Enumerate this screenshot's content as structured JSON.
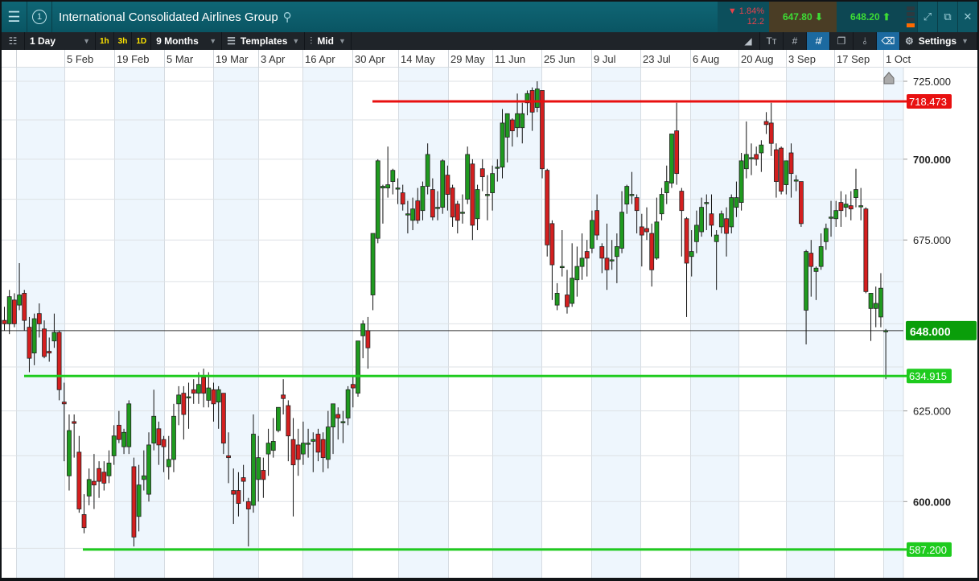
{
  "window": {
    "title": "International Consolidated Airlines Group",
    "number": "1"
  },
  "quote": {
    "change_pct": "▼ 1.84%",
    "change_abs": "12.2",
    "sell": "647.80",
    "buy": "648.20"
  },
  "toolbar": {
    "interval": "1 Day",
    "quick": [
      "1h",
      "3h",
      "1D"
    ],
    "range": "9 Months",
    "templates": "Templates",
    "price_type": "Mid",
    "settings": "Settings"
  },
  "colors": {
    "up": "#1f9a1f",
    "down": "#d41f1f",
    "resistance": "#e81010",
    "support": "#1ecb1e",
    "current": "#0a9e0a"
  },
  "date_labels": [
    "5 Feb",
    "19 Feb",
    "5 Mar",
    "19 Mar",
    "3 Apr",
    "16 Apr",
    "30 Apr",
    "14 May",
    "29 May",
    "11 Jun",
    "25 Jun",
    "9 Jul",
    "23 Jul",
    "6 Aug",
    "20 Aug",
    "3 Sep",
    "17 Sep",
    "1 Oct"
  ],
  "chart_data": {
    "type": "candlestick",
    "scale": "log",
    "price_ticks": [
      "725.000",
      "700.000",
      "675.000",
      "625.000",
      "600.000"
    ],
    "current_price": 648.0,
    "current_label": "648.000",
    "levels": [
      {
        "name": "resistance",
        "value": 718.473,
        "label": "718.473"
      },
      {
        "name": "support-1",
        "value": 634.915,
        "label": "634.915"
      },
      {
        "name": "support-2",
        "value": 587.2,
        "label": "587.200"
      }
    ],
    "candles": [
      [
        651,
        655,
        648,
        650
      ],
      [
        650,
        660,
        647,
        658
      ],
      [
        657,
        659,
        649,
        650
      ],
      [
        655.5,
        668,
        654,
        658.5
      ],
      [
        659,
        660,
        648,
        651
      ],
      [
        649,
        652,
        636,
        640
      ],
      [
        641.5,
        653,
        638,
        651.5
      ],
      [
        653,
        656,
        646,
        650
      ],
      [
        648.5,
        651,
        640,
        640.5
      ],
      [
        642,
        646,
        639,
        641.5
      ],
      [
        645,
        653,
        643,
        647.5
      ],
      [
        647.5,
        648,
        628,
        631
      ],
      [
        627.5,
        633,
        611,
        627
      ],
      [
        607,
        624,
        603,
        619.5
      ],
      [
        622,
        624,
        612,
        621.5
      ],
      [
        613.5,
        618,
        597,
        598
      ],
      [
        596.5,
        602,
        591.5,
        593
      ],
      [
        601.5,
        609,
        599,
        606
      ],
      [
        605.5,
        613,
        598,
        604.5
      ],
      [
        609,
        611,
        601,
        605.5
      ],
      [
        608,
        611,
        603,
        605
      ],
      [
        607,
        614,
        605,
        610.5
      ],
      [
        612.5,
        621,
        610,
        618
      ],
      [
        621,
        625,
        616,
        617
      ],
      [
        615,
        620,
        613,
        619
      ],
      [
        615,
        628,
        613,
        627
      ],
      [
        609.5,
        612,
        588,
        590.5
      ],
      [
        596,
        610,
        592,
        604.5
      ],
      [
        606,
        614,
        603,
        607
      ],
      [
        602,
        619,
        600,
        615.5
      ],
      [
        616,
        631,
        614,
        623.5
      ],
      [
        620,
        622,
        610,
        615.5
      ],
      [
        617,
        618,
        608,
        615
      ],
      [
        609.5,
        618,
        606,
        611.5
      ],
      [
        611.5,
        627,
        608,
        623.5
      ],
      [
        627,
        632,
        621,
        629.5
      ],
      [
        630,
        632,
        617,
        624
      ],
      [
        629,
        633,
        620,
        629
      ],
      [
        631,
        634,
        627,
        630
      ],
      [
        630,
        636,
        627,
        632.5
      ],
      [
        634.5,
        637,
        626,
        630
      ],
      [
        628,
        636,
        626,
        631.5
      ],
      [
        631,
        633,
        622,
        627
      ],
      [
        627.5,
        632,
        620,
        631
      ],
      [
        630,
        630,
        613,
        616
      ],
      [
        612.5,
        619,
        605,
        612
      ],
      [
        603,
        609,
        594,
        602
      ],
      [
        603,
        608,
        596,
        599.5
      ],
      [
        606.5,
        610,
        600,
        605.5
      ],
      [
        600,
        601,
        588,
        598
      ],
      [
        599,
        624,
        597,
        618.5
      ],
      [
        606,
        618,
        600,
        612
      ],
      [
        608.5,
        612,
        601,
        606
      ],
      [
        613,
        620,
        607,
        616
      ],
      [
        614,
        623,
        612,
        616.5
      ],
      [
        619.5,
        626,
        619,
        626
      ],
      [
        629.5,
        634,
        624,
        628.5
      ],
      [
        626.5,
        628,
        611,
        618
      ],
      [
        617,
        623,
        596,
        610
      ],
      [
        615.5,
        620,
        607,
        611.5
      ],
      [
        613,
        622,
        610,
        616
      ],
      [
        616,
        620,
        612,
        616
      ],
      [
        616.5,
        619,
        608,
        617
      ],
      [
        618.5,
        620,
        611,
        613.5
      ],
      [
        617,
        619,
        608,
        612
      ],
      [
        611.5,
        625,
        609,
        620.5
      ],
      [
        620.5,
        627,
        613,
        627
      ],
      [
        624,
        626,
        617,
        623
      ],
      [
        622,
        625,
        616,
        622
      ],
      [
        623,
        632,
        621,
        631
      ],
      [
        632.5,
        635,
        626,
        631.5
      ],
      [
        630,
        645,
        629,
        645
      ],
      [
        646.5,
        651,
        640,
        650
      ],
      [
        648,
        652,
        637,
        643
      ],
      [
        658.5,
        662,
        654,
        677
      ],
      [
        675.5,
        700,
        674,
        699.5
      ],
      [
        691,
        692,
        680,
        691.5
      ],
      [
        691,
        704,
        688,
        692
      ],
      [
        693,
        697,
        689,
        696.5
      ],
      [
        691,
        694,
        686,
        691
      ],
      [
        689.5,
        692,
        684,
        686
      ],
      [
        683,
        687,
        677,
        683
      ],
      [
        681,
        688,
        678,
        684.5
      ],
      [
        687,
        691,
        680,
        681
      ],
      [
        684,
        693,
        681,
        691.5
      ],
      [
        691.5,
        705,
        689,
        701.5
      ],
      [
        690.5,
        694,
        681,
        682
      ],
      [
        685,
        690,
        681,
        685
      ],
      [
        685,
        700,
        683,
        699.5
      ],
      [
        695,
        698,
        684,
        689
      ],
      [
        691,
        692,
        679,
        682
      ],
      [
        686,
        687,
        677,
        681
      ],
      [
        683.5,
        689,
        680,
        683.5
      ],
      [
        687.5,
        704,
        686,
        701.5
      ],
      [
        698.5,
        700,
        675,
        679.5
      ],
      [
        681.5,
        692,
        678,
        690.5
      ],
      [
        697,
        700,
        690,
        694.5
      ],
      [
        689,
        695,
        681,
        689
      ],
      [
        689.5,
        698,
        684,
        695.5
      ],
      [
        697.5,
        700,
        693,
        697.5
      ],
      [
        697.5,
        716,
        694,
        711.5
      ],
      [
        707,
        714,
        699,
        714.5
      ],
      [
        712.5,
        713,
        704,
        709
      ],
      [
        710,
        721,
        707,
        714.5
      ],
      [
        710,
        718,
        705,
        714.5
      ],
      [
        718,
        722,
        714,
        721
      ],
      [
        722,
        723,
        709,
        715
      ],
      [
        716.5,
        725,
        715,
        722.5
      ],
      [
        722,
        722,
        694,
        697
      ],
      [
        696.5,
        697,
        670,
        673.5
      ],
      [
        680,
        681,
        657,
        667.5
      ],
      [
        655.5,
        662,
        654,
        659
      ],
      [
        667,
        678,
        664,
        667
      ],
      [
        658.5,
        666,
        653,
        655
      ],
      [
        656,
        674,
        655,
        663.5
      ],
      [
        663,
        673,
        658,
        667
      ],
      [
        667,
        677,
        663,
        669.5
      ],
      [
        671.5,
        675,
        664,
        669.5
      ],
      [
        672.5,
        684,
        671,
        681
      ],
      [
        684,
        689,
        675,
        676.5
      ],
      [
        673,
        674,
        665,
        669.5
      ],
      [
        669.5,
        680,
        660,
        666
      ],
      [
        669,
        675,
        666,
        669
      ],
      [
        670,
        677,
        662,
        673
      ],
      [
        672.5,
        690,
        671,
        683.5
      ],
      [
        686,
        692,
        683,
        691.5
      ],
      [
        689,
        696,
        686,
        689
      ],
      [
        688,
        689,
        677,
        684
      ],
      [
        679,
        683,
        667,
        676.5
      ],
      [
        678.5,
        685,
        675,
        677.5
      ],
      [
        677,
        680,
        661,
        666
      ],
      [
        669.5,
        688,
        669,
        680.5
      ],
      [
        683,
        691,
        681,
        689
      ],
      [
        689.5,
        698,
        686,
        693
      ],
      [
        692.5,
        704,
        691,
        708
      ],
      [
        709,
        718,
        692,
        695.5
      ],
      [
        690,
        691,
        670,
        684
      ],
      [
        681.5,
        682,
        652,
        668
      ],
      [
        670,
        678,
        664,
        671.5
      ],
      [
        674.5,
        684,
        671,
        679.5
      ],
      [
        677.5,
        688,
        676,
        685
      ],
      [
        686.5,
        689,
        678,
        686.5
      ],
      [
        683,
        689,
        676,
        679.5
      ],
      [
        674.5,
        678,
        660,
        676.5
      ],
      [
        679,
        684,
        677,
        683
      ],
      [
        681.5,
        685,
        670,
        677
      ],
      [
        679,
        689,
        677,
        688
      ],
      [
        685,
        693,
        682,
        688
      ],
      [
        686.5,
        702,
        684,
        699.5
      ],
      [
        697,
        712,
        694,
        701.5
      ],
      [
        700.5,
        705,
        695,
        700.5
      ],
      [
        701.5,
        704,
        698,
        700
      ],
      [
        702,
        706,
        696,
        704.5
      ],
      [
        712,
        715,
        708,
        711
      ],
      [
        711.5,
        718,
        701,
        705
      ],
      [
        703,
        705,
        688,
        693
      ],
      [
        703.5,
        704,
        689,
        690
      ],
      [
        692,
        699,
        689,
        699.5
      ],
      [
        702,
        705,
        688,
        695.5
      ],
      [
        693.5,
        695,
        690,
        693.5
      ],
      [
        693,
        693,
        679,
        680
      ],
      [
        654,
        672,
        644,
        671.5
      ],
      [
        671,
        675,
        658,
        667
      ],
      [
        665.5,
        667,
        657,
        666.5
      ],
      [
        667,
        677,
        666,
        673
      ],
      [
        674.5,
        680,
        672,
        678.5
      ],
      [
        682,
        687,
        676,
        682
      ],
      [
        681.5,
        687,
        679,
        684
      ],
      [
        686.5,
        690,
        679,
        684
      ],
      [
        685,
        689,
        682,
        686
      ],
      [
        685.5,
        690,
        681,
        684.5
      ],
      [
        688,
        697,
        685,
        690.5
      ],
      [
        685.5,
        691,
        681,
        685.5
      ],
      [
        684.5,
        685,
        659,
        659.5
      ],
      [
        654.5,
        659,
        645,
        659
      ],
      [
        654.5,
        661,
        649,
        656
      ],
      [
        652,
        665,
        649,
        660.5
      ],
      [
        648,
        648.5,
        634,
        648
      ]
    ]
  }
}
